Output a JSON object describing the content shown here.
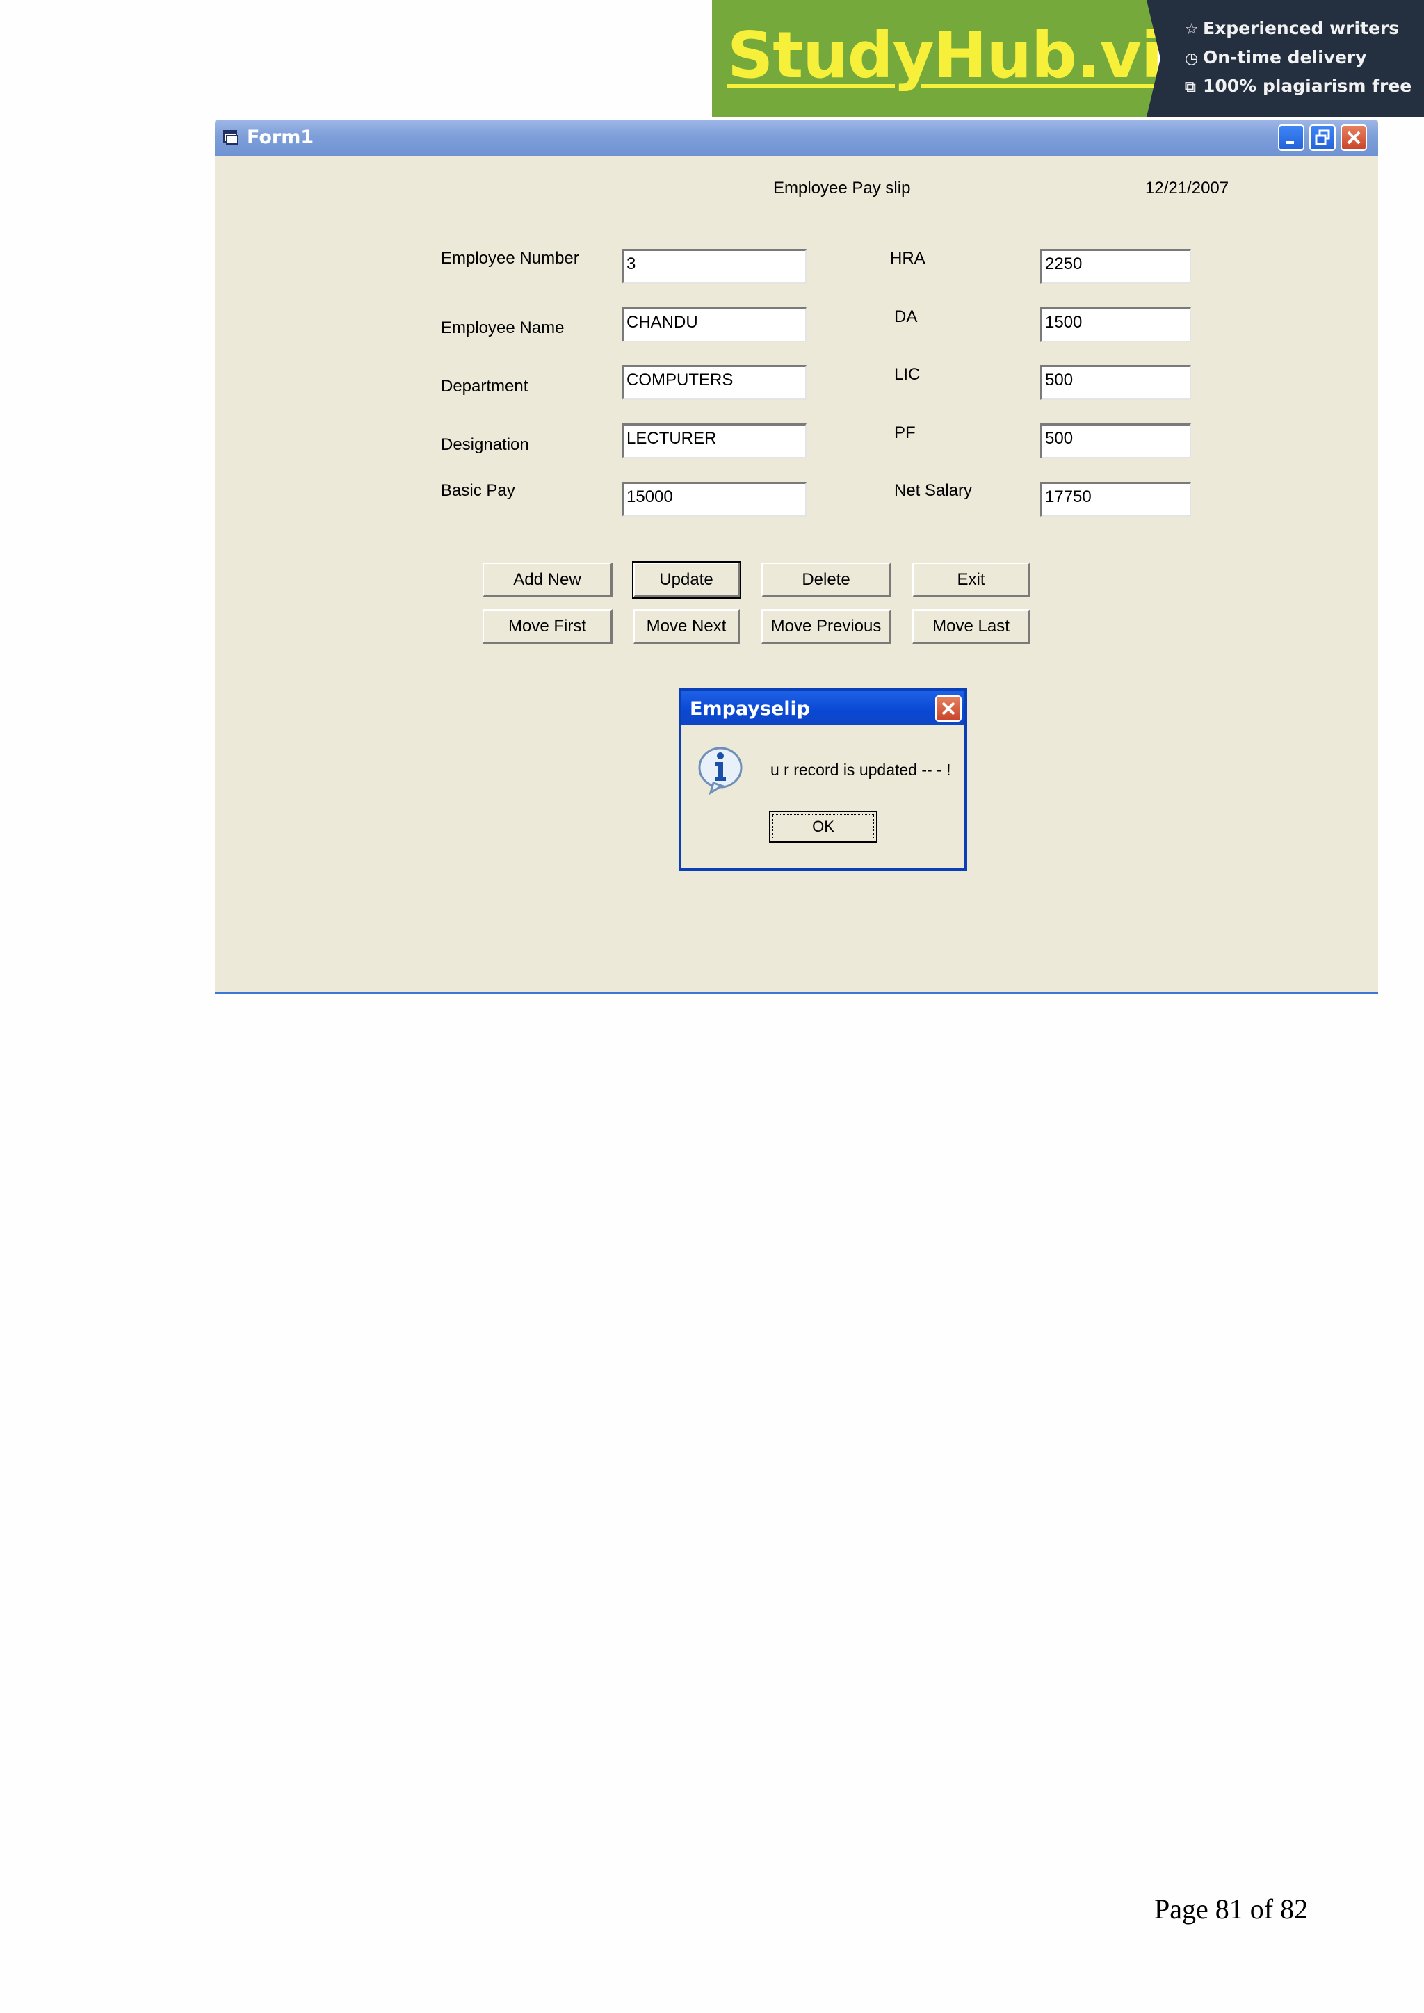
{
  "banner": {
    "brand": "StudyHub.vip",
    "features": [
      {
        "icon": "star-icon",
        "label": "Experienced writers"
      },
      {
        "icon": "clock-icon",
        "label": "On-time delivery"
      },
      {
        "icon": "copy-icon",
        "label": "100% plagiarism free"
      }
    ],
    "colors": {
      "left": "#76a93b",
      "right": "#243040",
      "brand_text": "#f6f03a"
    }
  },
  "window": {
    "title": "Form1",
    "heading": "Employee  Pay slip",
    "date": "12/21/2007",
    "fields_left": [
      {
        "label": "Employee Number",
        "value": "3"
      },
      {
        "label": "Employee Name",
        "value": "CHANDU"
      },
      {
        "label": "Department",
        "value": "COMPUTERS"
      },
      {
        "label": "Designation",
        "value": "LECTURER"
      },
      {
        "label": "Basic Pay",
        "value": "15000"
      }
    ],
    "fields_right": [
      {
        "label": "HRA",
        "value": "2250"
      },
      {
        "label": "DA",
        "value": "1500"
      },
      {
        "label": "LIC",
        "value": "500"
      },
      {
        "label": "PF",
        "value": "500"
      },
      {
        "label": "Net Salary",
        "value": "17750"
      }
    ],
    "buttons_row1": [
      "Add New",
      "Update",
      "Delete",
      "Exit"
    ],
    "buttons_row2": [
      "Move First",
      "Move Next",
      "Move Previous",
      "Move Last"
    ]
  },
  "dialog": {
    "title": "Empayselip",
    "message": "u r record is updated -- - !",
    "ok_label": "OK"
  },
  "footer": {
    "page": "Page 81 of 82"
  }
}
